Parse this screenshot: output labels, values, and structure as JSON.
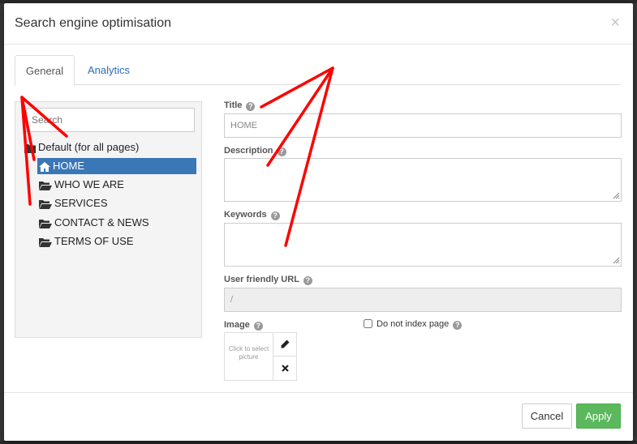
{
  "dialog": {
    "title": "Search engine optimisation",
    "close_symbol": "×"
  },
  "tabs": [
    {
      "label": "General",
      "active": true
    },
    {
      "label": "Analytics",
      "active": false
    }
  ],
  "tree": {
    "search_placeholder": "Search",
    "root": "Default (for all pages)",
    "items": [
      {
        "label": "HOME",
        "icon": "home-icon",
        "selected": true
      },
      {
        "label": "WHO WE ARE",
        "icon": "folder-open-icon",
        "selected": false
      },
      {
        "label": "SERVICES",
        "icon": "folder-open-icon",
        "selected": false
      },
      {
        "label": "CONTACT & NEWS",
        "icon": "folder-open-icon",
        "selected": false
      },
      {
        "label": "TERMS OF USE",
        "icon": "folder-open-icon",
        "selected": false
      }
    ]
  },
  "form": {
    "title_label": "Title",
    "title_value": "HOME",
    "description_label": "Description",
    "description_value": "",
    "keywords_label": "Keywords",
    "keywords_value": "",
    "url_label": "User friendly URL",
    "url_value": "/",
    "image_label": "Image",
    "image_placeholder": "Click to select picture",
    "noindex_label": "Do not index page",
    "noindex_checked": false
  },
  "footer": {
    "cancel_label": "Cancel",
    "apply_label": "Apply"
  },
  "colors": {
    "accent": "#3a77b6",
    "apply": "#5cb85c",
    "annotation": "#ff0000"
  }
}
